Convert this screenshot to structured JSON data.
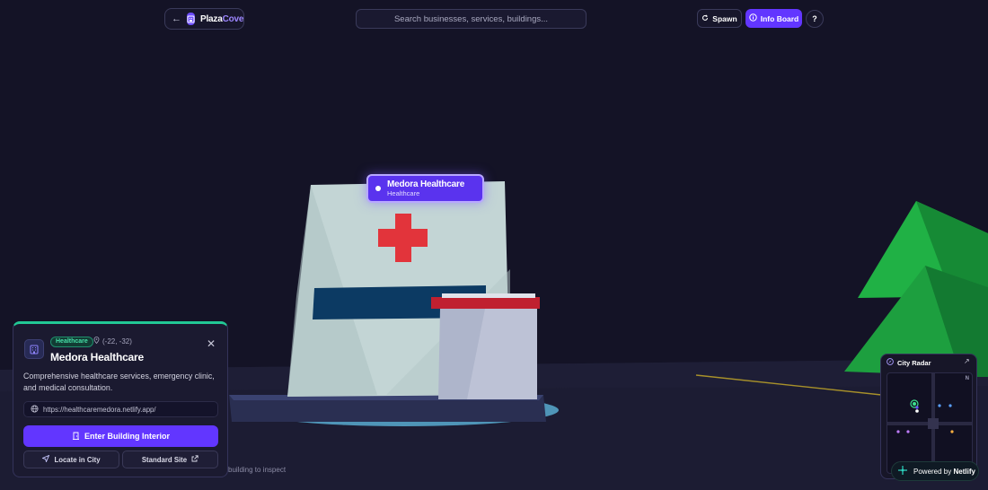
{
  "app": {
    "back_icon": "arrow-left-icon",
    "brand_prefix": "Plaza",
    "brand_suffix": "Cove",
    "brand_icon": "building-icon"
  },
  "search": {
    "placeholder": "Search businesses, services, buildings..."
  },
  "toolbar": {
    "spawn_label": "Spawn",
    "spawn_icon": "refresh-icon",
    "info_label": "Info Board",
    "info_icon": "info-icon",
    "help_label": "?"
  },
  "building_label": {
    "name": "Medora Healthcare",
    "category": "Healthcare"
  },
  "panel": {
    "accent": "#22c995",
    "category": "Healthcare",
    "coords": "(-22, -32)",
    "title": "Medora Healthcare",
    "description": "Comprehensive healthcare services, emergency clinic, and medical consultation.",
    "url": "https://healthcaremedora.netlify.app/",
    "enter_label": "Enter Building Interior",
    "locate_label": "Locate in City",
    "standard_label": "Standard Site"
  },
  "hint": "building to inspect",
  "radar": {
    "title": "City Radar",
    "north": "N"
  },
  "powered": {
    "prefix": "Powered by",
    "brand": "Netlify"
  },
  "colors": {
    "primary": "#6236ff",
    "background": "#141326"
  }
}
